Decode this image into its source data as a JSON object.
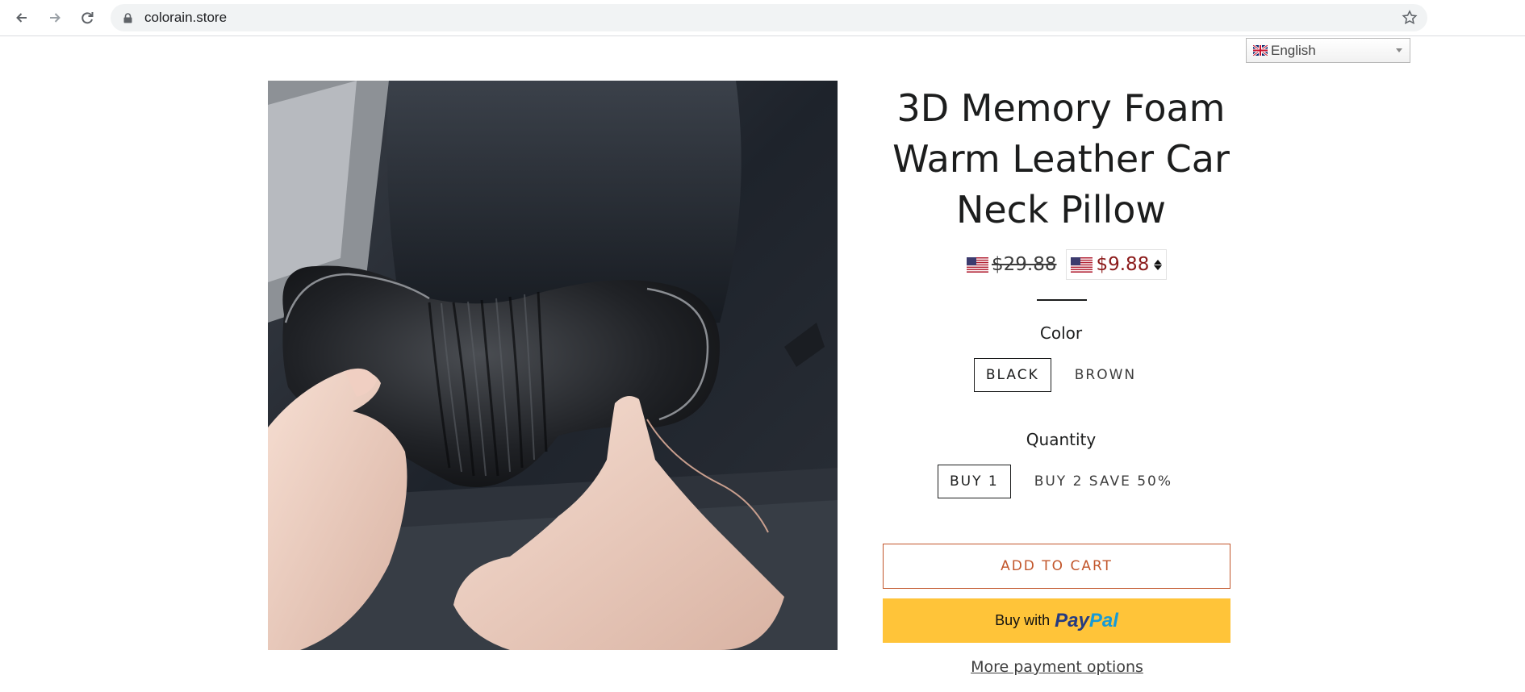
{
  "browser": {
    "url": "colorain.store"
  },
  "language": {
    "selected": "English"
  },
  "product": {
    "title_line1": "3D Memory Foam",
    "title_line2": "Warm Leather Car",
    "title_line3": "Neck Pillow",
    "compare_price": "$29.88",
    "price": "$9.88",
    "options": {
      "color_label": "Color",
      "colors": [
        "BLACK",
        "BROWN"
      ],
      "selected_color": "BLACK",
      "quantity_label": "Quantity",
      "quantities": [
        "BUY 1",
        "BUY 2 SAVE 50%"
      ],
      "selected_quantity": "BUY 1"
    },
    "add_to_cart_label": "ADD TO CART",
    "paypal": {
      "prefix": "Buy with",
      "brand_part1": "Pay",
      "brand_part2": "Pal"
    },
    "more_payment_label": "More payment options"
  },
  "colors": {
    "accent": "#c2562b",
    "sale_price": "#8b1a1a",
    "paypal_yellow": "#ffc439"
  }
}
